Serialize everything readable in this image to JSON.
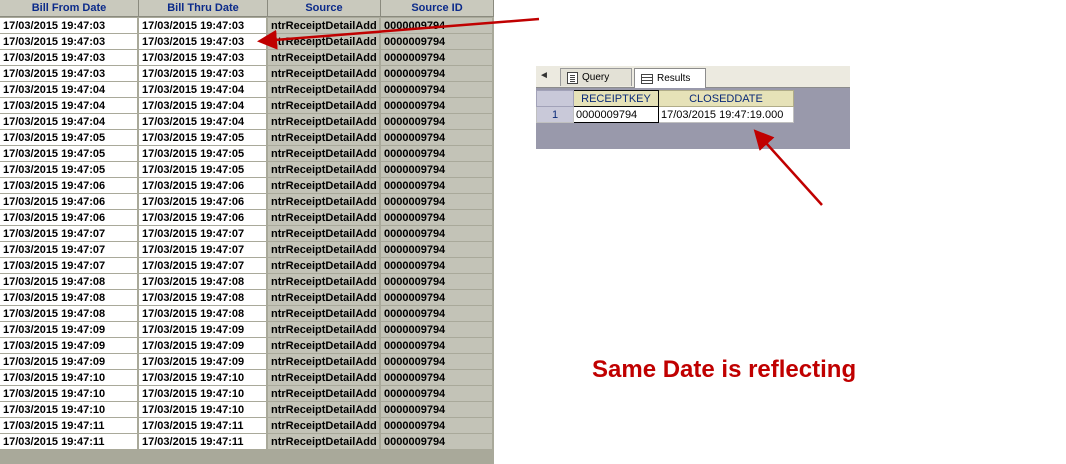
{
  "grid": {
    "columns": [
      "Bill From Date",
      "Bill Thru Date",
      "Source",
      "Source ID"
    ],
    "rows": [
      [
        "17/03/2015 19:47:03",
        "17/03/2015 19:47:03",
        "ntrReceiptDetailAdd",
        "0000009794"
      ],
      [
        "17/03/2015 19:47:03",
        "17/03/2015 19:47:03",
        "ntrReceiptDetailAdd",
        "0000009794"
      ],
      [
        "17/03/2015 19:47:03",
        "17/03/2015 19:47:03",
        "ntrReceiptDetailAdd",
        "0000009794"
      ],
      [
        "17/03/2015 19:47:03",
        "17/03/2015 19:47:03",
        "ntrReceiptDetailAdd",
        "0000009794"
      ],
      [
        "17/03/2015 19:47:04",
        "17/03/2015 19:47:04",
        "ntrReceiptDetailAdd",
        "0000009794"
      ],
      [
        "17/03/2015 19:47:04",
        "17/03/2015 19:47:04",
        "ntrReceiptDetailAdd",
        "0000009794"
      ],
      [
        "17/03/2015 19:47:04",
        "17/03/2015 19:47:04",
        "ntrReceiptDetailAdd",
        "0000009794"
      ],
      [
        "17/03/2015 19:47:05",
        "17/03/2015 19:47:05",
        "ntrReceiptDetailAdd",
        "0000009794"
      ],
      [
        "17/03/2015 19:47:05",
        "17/03/2015 19:47:05",
        "ntrReceiptDetailAdd",
        "0000009794"
      ],
      [
        "17/03/2015 19:47:05",
        "17/03/2015 19:47:05",
        "ntrReceiptDetailAdd",
        "0000009794"
      ],
      [
        "17/03/2015 19:47:06",
        "17/03/2015 19:47:06",
        "ntrReceiptDetailAdd",
        "0000009794"
      ],
      [
        "17/03/2015 19:47:06",
        "17/03/2015 19:47:06",
        "ntrReceiptDetailAdd",
        "0000009794"
      ],
      [
        "17/03/2015 19:47:06",
        "17/03/2015 19:47:06",
        "ntrReceiptDetailAdd",
        "0000009794"
      ],
      [
        "17/03/2015 19:47:07",
        "17/03/2015 19:47:07",
        "ntrReceiptDetailAdd",
        "0000009794"
      ],
      [
        "17/03/2015 19:47:07",
        "17/03/2015 19:47:07",
        "ntrReceiptDetailAdd",
        "0000009794"
      ],
      [
        "17/03/2015 19:47:07",
        "17/03/2015 19:47:07",
        "ntrReceiptDetailAdd",
        "0000009794"
      ],
      [
        "17/03/2015 19:47:08",
        "17/03/2015 19:47:08",
        "ntrReceiptDetailAdd",
        "0000009794"
      ],
      [
        "17/03/2015 19:47:08",
        "17/03/2015 19:47:08",
        "ntrReceiptDetailAdd",
        "0000009794"
      ],
      [
        "17/03/2015 19:47:08",
        "17/03/2015 19:47:08",
        "ntrReceiptDetailAdd",
        "0000009794"
      ],
      [
        "17/03/2015 19:47:09",
        "17/03/2015 19:47:09",
        "ntrReceiptDetailAdd",
        "0000009794"
      ],
      [
        "17/03/2015 19:47:09",
        "17/03/2015 19:47:09",
        "ntrReceiptDetailAdd",
        "0000009794"
      ],
      [
        "17/03/2015 19:47:09",
        "17/03/2015 19:47:09",
        "ntrReceiptDetailAdd",
        "0000009794"
      ],
      [
        "17/03/2015 19:47:10",
        "17/03/2015 19:47:10",
        "ntrReceiptDetailAdd",
        "0000009794"
      ],
      [
        "17/03/2015 19:47:10",
        "17/03/2015 19:47:10",
        "ntrReceiptDetailAdd",
        "0000009794"
      ],
      [
        "17/03/2015 19:47:10",
        "17/03/2015 19:47:10",
        "ntrReceiptDetailAdd",
        "0000009794"
      ],
      [
        "17/03/2015 19:47:11",
        "17/03/2015 19:47:11",
        "ntrReceiptDetailAdd",
        "0000009794"
      ],
      [
        "17/03/2015 19:47:11",
        "17/03/2015 19:47:11",
        "ntrReceiptDetailAdd",
        "0000009794"
      ]
    ]
  },
  "results_pane": {
    "scroll_left_glyph": "◄",
    "tabs": [
      {
        "label": "Query",
        "icon": "query-icon"
      },
      {
        "label": "Results",
        "icon": "results-grid-icon"
      }
    ],
    "columns": [
      "RECEIPTKEY",
      "CLOSEDDATE"
    ],
    "rows": [
      {
        "num": "1",
        "receiptkey": "0000009794",
        "closeddate": "17/03/2015 19:47:19.000"
      }
    ]
  },
  "annotation": {
    "caption": "Same Date is reflecting",
    "caption_color": "#c00000",
    "arrow_color": "#c00000"
  }
}
